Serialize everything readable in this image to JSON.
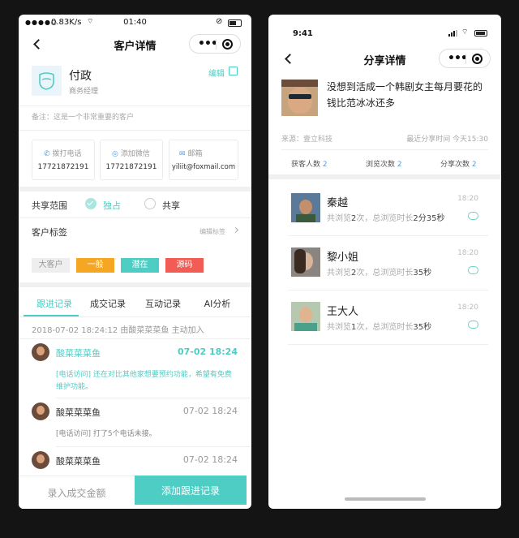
{
  "left_phone": {
    "status_bar": {
      "carrier_signal": "●●●●○",
      "speed": "0.83K/s",
      "time": "01:40"
    },
    "nav": {
      "title": "客户详情"
    },
    "customer": {
      "name": "付政",
      "role": "商务经理",
      "edit_label": "编辑"
    },
    "remark": "备注：这是一个非常重要的客户",
    "contacts": [
      {
        "label": "拨打电话",
        "value": "17721872191",
        "icon": "phone-icon"
      },
      {
        "label": "添加微信",
        "value": "17721872191",
        "icon": "wechat-icon"
      },
      {
        "label": "邮箱",
        "value": "yiliit@foxmail.com",
        "icon": "mail-icon"
      }
    ],
    "share_scope": {
      "label": "共享范围",
      "options": [
        "独占",
        "共享"
      ],
      "selected": "独占"
    },
    "customer_tags": {
      "label": "客户标签",
      "edit_label": "编辑标签",
      "tags": [
        {
          "text": "大客户",
          "bg": "#eeeeee",
          "fg": "#999999"
        },
        {
          "text": "一般",
          "bg": "#f5a623",
          "fg": "#ffffff"
        },
        {
          "text": "潜在",
          "bg": "#4ecdc4",
          "fg": "#ffffff"
        },
        {
          "text": "源码",
          "bg": "#f25c54",
          "fg": "#ffffff"
        }
      ]
    },
    "tabs": [
      "跟进记录",
      "成交记录",
      "互动记录",
      "AI分析"
    ],
    "active_tab": "跟进记录",
    "log_header": "2018-07-02 18:24:12 由酸菜菜菜鱼 主动加入",
    "records": [
      {
        "name": "酸菜菜菜鱼",
        "time": "07-02 18:24",
        "note": "[电话访问] 还在对比其他家想要预约功能，希望有免费维护功能。",
        "highlighted": true
      },
      {
        "name": "酸菜菜菜鱼",
        "time": "07-02 18:24",
        "note": "[电话访问] 打了5个电话未接。",
        "highlighted": false
      },
      {
        "name": "酸菜菜菜鱼",
        "time": "07-02 18:24",
        "note": "",
        "highlighted": false
      }
    ],
    "actions": {
      "record_deal": "录入成交金额",
      "add_followup": "添加跟进记录"
    },
    "colors": {
      "accent": "#4ecdc4",
      "primary_button": "#4ecdc4"
    }
  },
  "right_phone": {
    "status_bar": {
      "time": "9:41"
    },
    "nav": {
      "title": "分享详情"
    },
    "article": {
      "title": "没想到活成一个韩剧女主每月要花的钱比范冰冰还多",
      "source": "来源：壹立科技",
      "last_share": "最近分享时间 今天15:30"
    },
    "stats": [
      {
        "label": "获客人数",
        "value": "2"
      },
      {
        "label": "浏览次数",
        "value": "2"
      },
      {
        "label": "分享次数",
        "value": "2"
      }
    ],
    "visitors": [
      {
        "name": "秦越",
        "views": "2",
        "duration": "2分35秒",
        "time": "18:20"
      },
      {
        "name": "黎小姐",
        "views": "2",
        "duration": "35秒",
        "time": "18:20"
      },
      {
        "name": "王大人",
        "views": "1",
        "duration": "35秒",
        "time": "18:20"
      }
    ],
    "visitor_text": {
      "prefix": "共浏览",
      "mid": "次，总浏览时长"
    }
  }
}
